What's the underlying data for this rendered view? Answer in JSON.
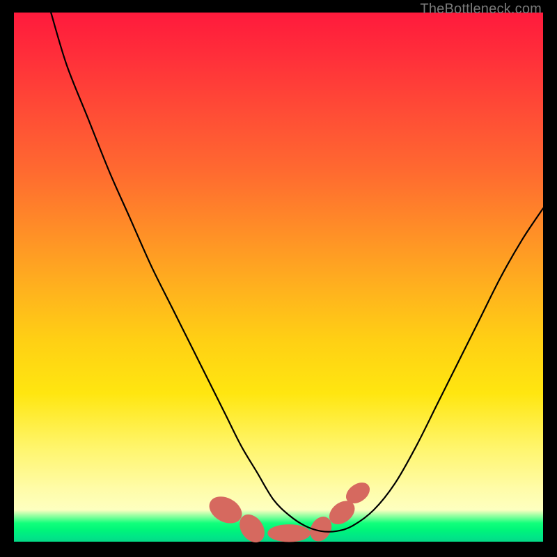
{
  "watermark": "TheBottleneck.com",
  "colors": {
    "gradient_top": "#ff1a3c",
    "gradient_mid": "#ffd014",
    "gradient_green": "#00e787",
    "curve": "#000000",
    "segment": "#d6695f",
    "frame": "#000000"
  },
  "chart_data": {
    "type": "line",
    "title": "",
    "xlabel": "",
    "ylabel": "",
    "xlim": [
      0,
      100
    ],
    "ylim": [
      0,
      100
    ],
    "annotations": [
      "TheBottleneck.com"
    ],
    "series": [
      {
        "name": "bottleneck-curve",
        "x": [
          7,
          10,
          14,
          18,
          22,
          26,
          30,
          34,
          37,
          40,
          43,
          46,
          49,
          52,
          55,
          58,
          61,
          64,
          68,
          72,
          76,
          80,
          84,
          88,
          92,
          96,
          100
        ],
        "y": [
          100,
          90,
          80,
          70,
          61,
          52,
          44,
          36,
          30,
          24,
          18,
          13,
          8,
          5,
          3,
          2,
          2,
          3,
          6,
          11,
          18,
          26,
          34,
          42,
          50,
          57,
          63
        ]
      }
    ],
    "segments": [
      {
        "name": "seg-left",
        "cx": 40,
        "cy": 6,
        "rx": 2.2,
        "ry": 3.2,
        "angle": -62
      },
      {
        "name": "seg-mid-left",
        "cx": 45,
        "cy": 2.5,
        "rx": 2.0,
        "ry": 2.8,
        "angle": -35
      },
      {
        "name": "seg-bottom",
        "cx": 52,
        "cy": 1.6,
        "rx": 4.0,
        "ry": 1.6,
        "angle": 0
      },
      {
        "name": "seg-mid-right",
        "cx": 58,
        "cy": 2.4,
        "rx": 1.8,
        "ry": 2.4,
        "angle": 30
      },
      {
        "name": "seg-right",
        "cx": 62,
        "cy": 5.5,
        "rx": 1.8,
        "ry": 2.6,
        "angle": 52
      },
      {
        "name": "seg-right-upper",
        "cx": 65,
        "cy": 9.2,
        "rx": 1.6,
        "ry": 2.4,
        "angle": 55
      }
    ]
  }
}
